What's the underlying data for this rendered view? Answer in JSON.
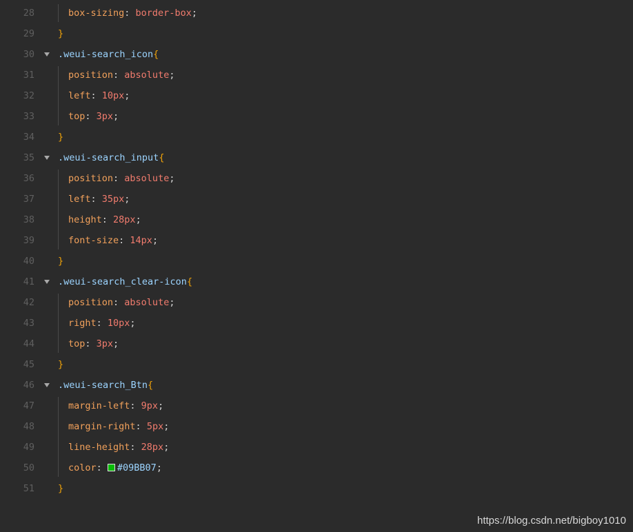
{
  "lines": [
    {
      "n": "28",
      "prop": "box-sizing",
      "val": "border-box"
    },
    {
      "n": "29",
      "close": "}"
    },
    {
      "n": "30",
      "selector": ".weui-search_icon",
      "open": "{"
    },
    {
      "n": "31",
      "prop": "position",
      "val": "absolute"
    },
    {
      "n": "32",
      "prop": "left",
      "val": "10px"
    },
    {
      "n": "33",
      "prop": "top",
      "val": "3px"
    },
    {
      "n": "34",
      "close": "}"
    },
    {
      "n": "35",
      "selector": ".weui-search_input",
      "open": "{"
    },
    {
      "n": "36",
      "prop": "position",
      "val": "absolute"
    },
    {
      "n": "37",
      "prop": "left",
      "val": "35px"
    },
    {
      "n": "38",
      "prop": "height",
      "val": "28px"
    },
    {
      "n": "39",
      "prop": "font-size",
      "val": "14px"
    },
    {
      "n": "40",
      "close": "}"
    },
    {
      "n": "41",
      "selector": ".weui-search_clear-icon",
      "open": "{"
    },
    {
      "n": "42",
      "prop": "position",
      "val": "absolute"
    },
    {
      "n": "43",
      "prop": "right",
      "val": "10px"
    },
    {
      "n": "44",
      "prop": "top",
      "val": "3px"
    },
    {
      "n": "45",
      "close": "}"
    },
    {
      "n": "46",
      "selector": ".weui-search_Btn",
      "open": "{"
    },
    {
      "n": "47",
      "prop": "margin-left",
      "val": "9px"
    },
    {
      "n": "48",
      "prop": "margin-right",
      "val": "5px"
    },
    {
      "n": "49",
      "prop": "line-height",
      "val": "28px"
    },
    {
      "n": "50",
      "prop": "color",
      "val": "#09BB07",
      "swatch": "#09BB07"
    },
    {
      "n": "51",
      "close": "}"
    }
  ],
  "watermark": "https://blog.csdn.net/bigboy1010",
  "colors": {
    "background": "#2b2b2b",
    "selector": "#9cd4ff",
    "brace": "#f0a30a",
    "property": "#f2a15b",
    "value": "#f27c6e"
  }
}
